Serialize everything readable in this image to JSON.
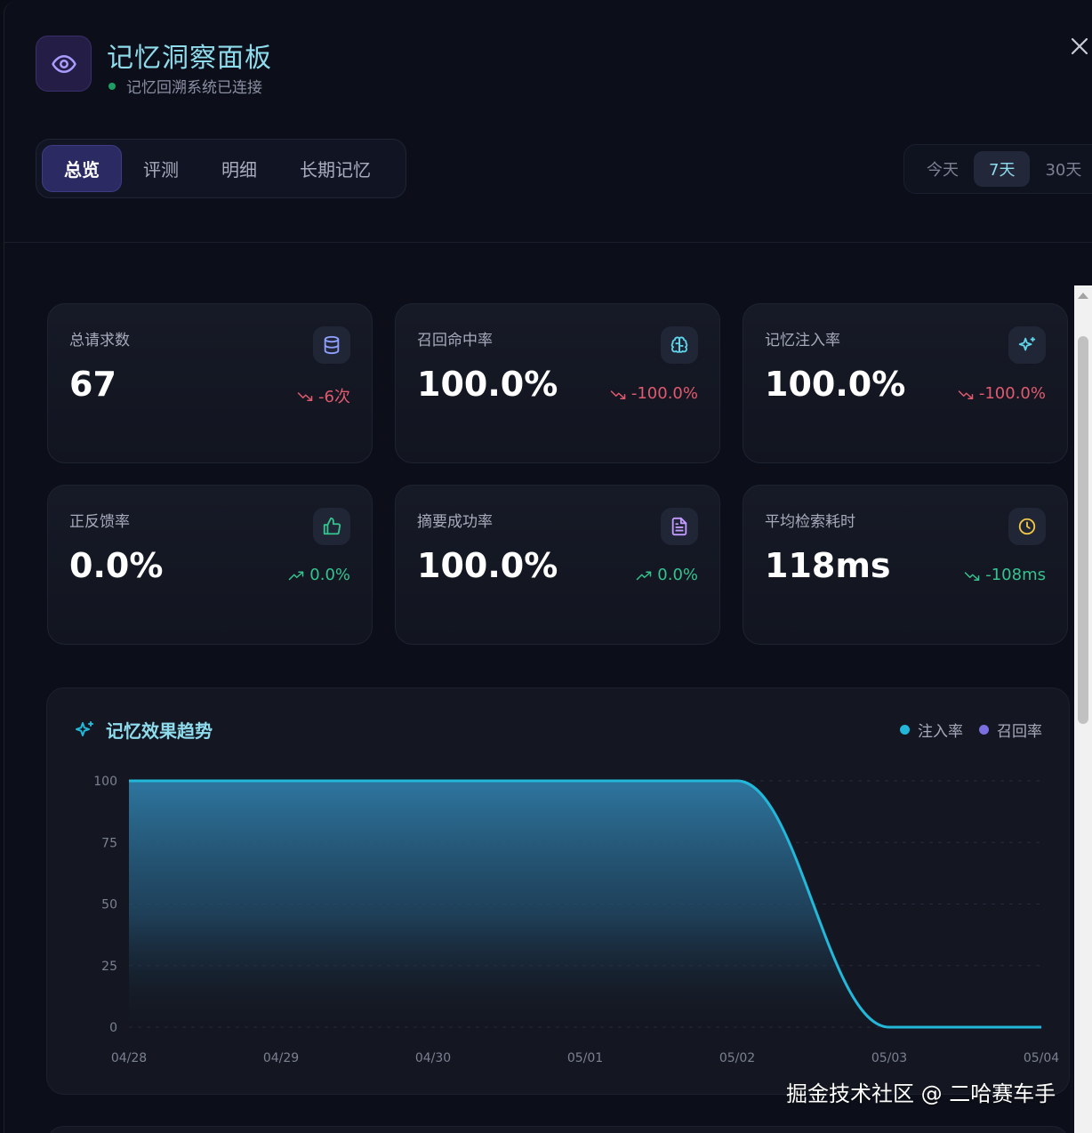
{
  "header": {
    "title": "记忆洞察面板",
    "status": "记忆回溯系统已连接",
    "status_color": "#1f9e63",
    "logo_icon": "eye-icon",
    "close_icon": "close-icon"
  },
  "tabs": [
    {
      "label": "总览",
      "active": true
    },
    {
      "label": "评测",
      "active": false
    },
    {
      "label": "明细",
      "active": false
    },
    {
      "label": "长期记忆",
      "active": false
    }
  ],
  "time_range": {
    "options": [
      "今天",
      "7天",
      "30天"
    ],
    "selected": "7天"
  },
  "stats": [
    {
      "label": "总请求数",
      "value": "67",
      "icon": "database-icon",
      "icon_color": "#8fa0ff",
      "trend": "-6次",
      "trend_dir": "down"
    },
    {
      "label": "召回命中率",
      "value": "100.0%",
      "icon": "brain-icon",
      "icon_color": "#5fd6ea",
      "trend": "-100.0%",
      "trend_dir": "down"
    },
    {
      "label": "记忆注入率",
      "value": "100.0%",
      "icon": "sparkles-icon",
      "icon_color": "#5fd6ea",
      "trend": "-100.0%",
      "trend_dir": "down"
    },
    {
      "label": "正反馈率",
      "value": "0.0%",
      "icon": "thumbs-up-icon",
      "icon_color": "#34c38f",
      "trend": "0.0%",
      "trend_dir": "up"
    },
    {
      "label": "摘要成功率",
      "value": "100.0%",
      "icon": "document-icon",
      "icon_color": "#c39bff",
      "trend": "0.0%",
      "trend_dir": "up"
    },
    {
      "label": "平均检索耗时",
      "value": "118ms",
      "icon": "clock-icon",
      "icon_color": "#f2c744",
      "trend": "-108ms",
      "trend_dir": "down-good"
    }
  ],
  "colors": {
    "trend_down": "#e05a6e",
    "trend_up": "#34c38f",
    "injection": "#22b8d9",
    "recall": "#7b6fe0",
    "accent": "#8fdcec"
  },
  "chart_data": {
    "type": "area",
    "title": "记忆效果趋势",
    "categories": [
      "04/28",
      "04/29",
      "04/30",
      "05/01",
      "05/02",
      "05/03",
      "05/04"
    ],
    "series": [
      {
        "name": "注入率",
        "values": [
          100,
          100,
          100,
          100,
          100,
          0,
          0
        ]
      },
      {
        "name": "召回率",
        "values": [
          100,
          100,
          100,
          100,
          100,
          0,
          0
        ]
      }
    ],
    "yticks": [
      0,
      25,
      50,
      75,
      100
    ],
    "ylim": [
      0,
      100
    ],
    "grid": true,
    "legend_position": "top-right"
  },
  "watermark": "掘金技术社区 @ 二哈赛车手"
}
